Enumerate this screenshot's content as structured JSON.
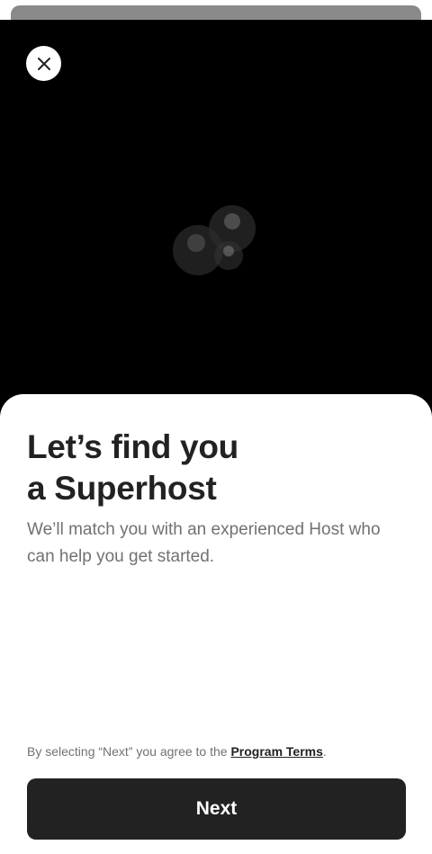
{
  "hero": {
    "close_icon": "close-icon",
    "illustration": "host-avatars-illustration"
  },
  "content": {
    "title_line1": "Let’s find you",
    "title_line2": "a Superhost",
    "subtitle": "We’ll match you with an experienced Host who can help you get started."
  },
  "footer": {
    "terms_prefix": "By selecting “Next” you agree to the ",
    "terms_link": "Program Terms",
    "terms_suffix": ".",
    "next_label": "Next"
  },
  "colors": {
    "primary_text": "#222222",
    "secondary_text": "#717171",
    "button_bg": "#222222",
    "hero_bg": "#000000"
  }
}
